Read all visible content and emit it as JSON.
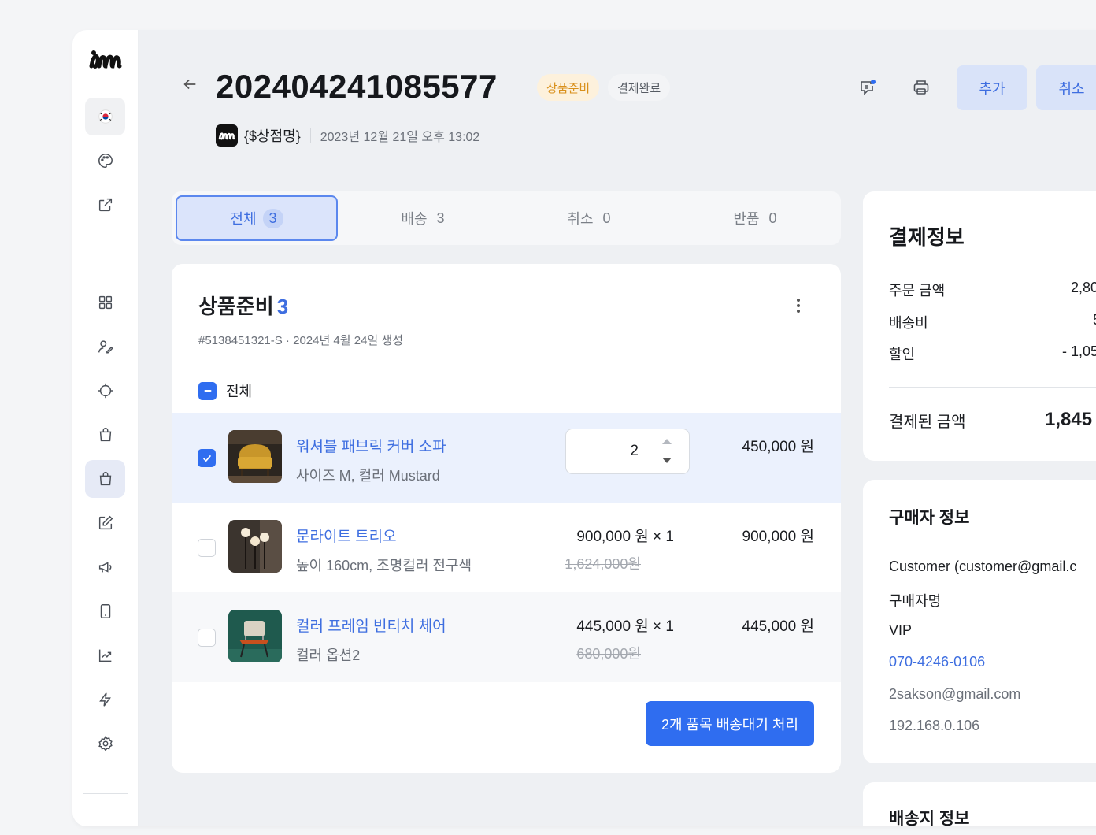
{
  "sidebar": {
    "items": [
      "flag-icon",
      "palette-icon",
      "external-link-icon",
      "grid-icon",
      "user-edit-icon",
      "crosshair-icon",
      "shopping-bag-icon",
      "shopping-bag-icon",
      "edit-icon",
      "megaphone-icon",
      "mobile-icon",
      "chart-icon",
      "bolt-icon",
      "gear-icon"
    ],
    "active_index": 7
  },
  "header": {
    "order_number": "202404241085577",
    "badge_status": "상품준비",
    "badge_payment": "결제완료",
    "store_name": "{$상점명}",
    "order_date": "2023년 12월 21일 오후 13:02",
    "add_button": "추가",
    "cancel_button": "취소"
  },
  "tabs": [
    {
      "label": "전체",
      "count": "3"
    },
    {
      "label": "배송",
      "count": "3"
    },
    {
      "label": "취소",
      "count": "0"
    },
    {
      "label": "반품",
      "count": "0"
    }
  ],
  "card": {
    "title": "상품준비",
    "title_count": "3",
    "meta": "#5138451321-S · 2024년 4월 24일 생성",
    "select_all_label": "전체",
    "action_button": "2개 품목 배송대기 처리"
  },
  "items": [
    {
      "name": "워셔블 패브릭 커버 소파",
      "option": "사이즈 M, 컬러 Mustard",
      "quantity": "2",
      "total": "450,000 원",
      "checked": true
    },
    {
      "name": "문라이트 트리오",
      "option": "높이 160cm, 조명컬러 전구색",
      "unit_price": "900,000 원 × 1",
      "original_price": "1,624,000원",
      "total": "900,000 원",
      "checked": false
    },
    {
      "name": "컬러 프레임 빈티치 체어",
      "option": "컬러 옵션2",
      "unit_price": "445,000 원 × 1",
      "original_price": "680,000원",
      "total": "445,000 원",
      "checked": false
    }
  ],
  "payment": {
    "title": "결제정보",
    "order_amount_label": "주문 금액",
    "order_amount_value": "2,80",
    "shipping_label": "배송비",
    "shipping_value": "5",
    "discount_label": "할인",
    "discount_value": "- 1,05",
    "paid_label": "결제된 금액",
    "paid_value": "1,845"
  },
  "buyer": {
    "title": "구매자 정보",
    "customer": "Customer (customer@gmail.c",
    "name": "구매자명",
    "grade": "VIP",
    "phone": "070-4246-0106",
    "email": "2sakson@gmail.com",
    "ip": "192.168.0.106"
  },
  "shipping": {
    "title": "배송지 정보"
  },
  "colors": {
    "accent": "#2f6df0",
    "link": "#3e6ee0",
    "badge_prep": "#d9901b",
    "background": "#eef0f3"
  }
}
